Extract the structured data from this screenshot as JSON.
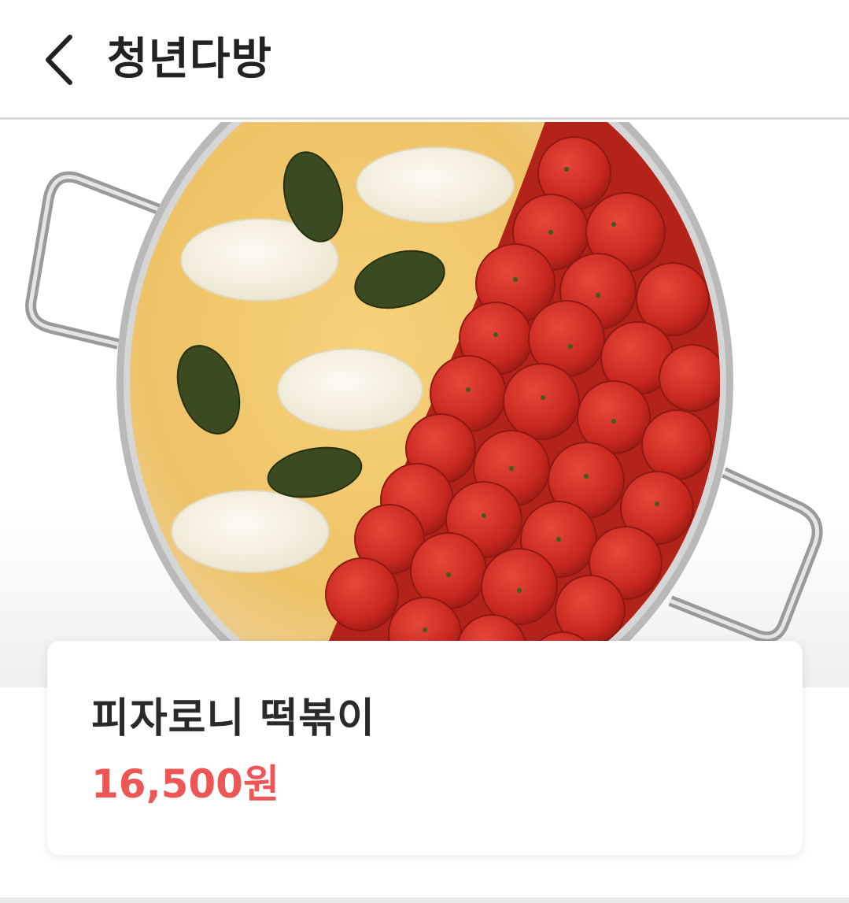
{
  "header": {
    "title": "청년다방",
    "back_icon": "chevron-left-icon"
  },
  "product": {
    "name": "피자로니 떡볶이",
    "price": "16,500원",
    "image_description_icon": "food-photo",
    "price_color": "#ee5555"
  }
}
